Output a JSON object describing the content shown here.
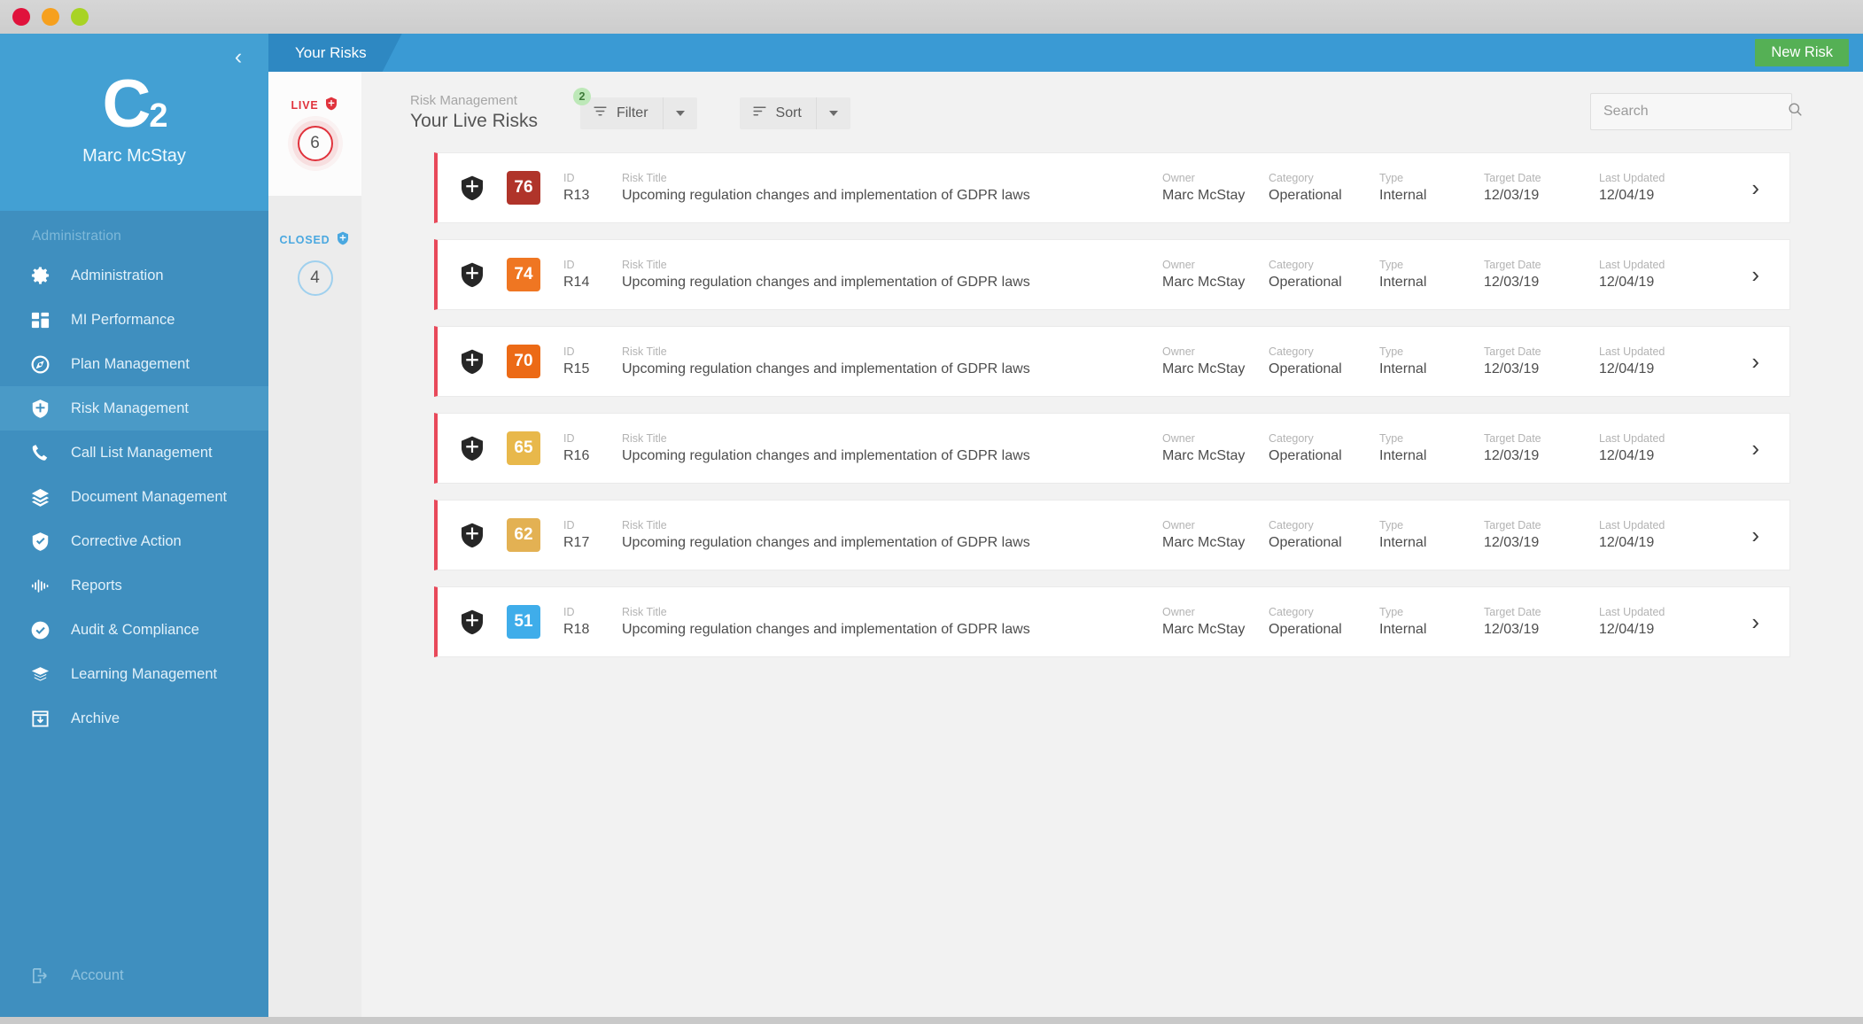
{
  "window": {
    "dots": [
      "red",
      "amber",
      "green"
    ]
  },
  "sidebar": {
    "logo_text": "C",
    "logo_sub": "2",
    "user_name": "Marc McStay",
    "section_label": "Administration",
    "items": [
      {
        "label": "Administration",
        "icon": "gear-icon"
      },
      {
        "label": "MI Performance",
        "icon": "dashboard-icon"
      },
      {
        "label": "Plan Management",
        "icon": "compass-icon"
      },
      {
        "label": "Risk Management",
        "icon": "shield-cross-icon"
      },
      {
        "label": "Call List Management",
        "icon": "phone-icon"
      },
      {
        "label": "Document Management",
        "icon": "layers-icon"
      },
      {
        "label": "Corrective Action",
        "icon": "shield-check-icon"
      },
      {
        "label": "Reports",
        "icon": "waveform-icon"
      },
      {
        "label": "Audit & Compliance",
        "icon": "check-circle-icon"
      },
      {
        "label": "Learning Management",
        "icon": "graduation-cap-icon"
      },
      {
        "label": "Archive",
        "icon": "archive-icon"
      }
    ],
    "active_item": "Risk Management",
    "account_label": "Account",
    "collapse_icon": "chevron-left-icon"
  },
  "topbar": {
    "tab_label": "Your Risks",
    "new_risk_label": "New Risk",
    "accent_color": "#3a9ad4",
    "new_risk_color": "#55b055"
  },
  "status_column": {
    "live": {
      "label": "LIVE",
      "count": "6",
      "color": "#e0323c",
      "icon": "shield-icon"
    },
    "closed": {
      "label": "CLOSED",
      "count": "4",
      "color": "#4aa8e0",
      "icon": "shield-icon"
    }
  },
  "toolbar": {
    "breadcrumb": "Risk Management",
    "page_title": "Your Live Risks",
    "filter_label": "Filter",
    "filter_badge": "2",
    "filter_badge_color": "#bde8b8",
    "sort_label": "Sort",
    "search_placeholder": "Search",
    "search_value": ""
  },
  "table": {
    "headers": {
      "id": "ID",
      "title": "Risk Title",
      "owner": "Owner",
      "category": "Category",
      "type": "Type",
      "target_date": "Target Date",
      "last_updated": "Last Updated"
    },
    "rows": [
      {
        "score": "76",
        "score_color": "#b0342a",
        "id": "R13",
        "title": "Upcoming regulation changes and implementation of GDPR laws",
        "owner": "Marc McStay",
        "category": "Operational",
        "type": "Internal",
        "target_date": "12/03/19",
        "last_updated": "12/04/19"
      },
      {
        "score": "74",
        "score_color": "#ef7622",
        "id": "R14",
        "title": "Upcoming regulation changes and implementation of GDPR laws",
        "owner": "Marc McStay",
        "category": "Operational",
        "type": "Internal",
        "target_date": "12/03/19",
        "last_updated": "12/04/19"
      },
      {
        "score": "70",
        "score_color": "#ec6a16",
        "id": "R15",
        "title": "Upcoming regulation changes and implementation of GDPR laws",
        "owner": "Marc McStay",
        "category": "Operational",
        "type": "Internal",
        "target_date": "12/03/19",
        "last_updated": "12/04/19"
      },
      {
        "score": "65",
        "score_color": "#e8b84b",
        "id": "R16",
        "title": "Upcoming regulation changes and implementation of GDPR laws",
        "owner": "Marc McStay",
        "category": "Operational",
        "type": "Internal",
        "target_date": "12/03/19",
        "last_updated": "12/04/19"
      },
      {
        "score": "62",
        "score_color": "#e3b153",
        "id": "R17",
        "title": "Upcoming regulation changes and implementation of GDPR laws",
        "owner": "Marc McStay",
        "category": "Operational",
        "type": "Internal",
        "target_date": "12/03/19",
        "last_updated": "12/04/19"
      },
      {
        "score": "51",
        "score_color": "#3fadea",
        "id": "R18",
        "title": "Upcoming regulation changes and implementation of GDPR laws",
        "owner": "Marc McStay",
        "category": "Operational",
        "type": "Internal",
        "target_date": "12/03/19",
        "last_updated": "12/04/19"
      }
    ]
  }
}
